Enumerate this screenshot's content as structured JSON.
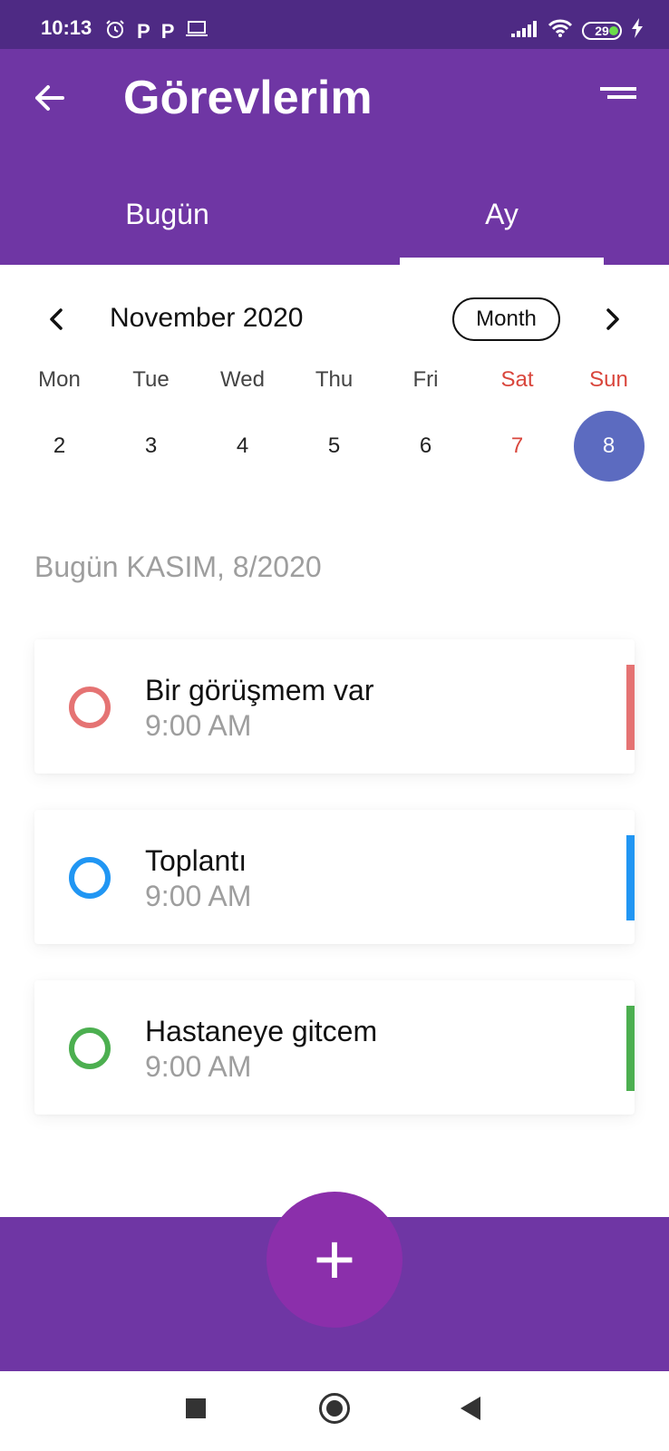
{
  "status_bar": {
    "time": "10:13",
    "battery": "29",
    "icons": [
      "alarm-icon",
      "p-icon",
      "p-icon",
      "laptop-icon",
      "signal-icon",
      "wifi-icon",
      "battery-icon",
      "charging-icon"
    ]
  },
  "app_bar": {
    "title": "Görevlerim",
    "tabs": [
      {
        "label": "Bugün",
        "selected": false
      },
      {
        "label": "Ay",
        "selected": true
      }
    ]
  },
  "calendar": {
    "month_title": "November 2020",
    "format_button": "Month",
    "weekdays": [
      "Mon",
      "Tue",
      "Wed",
      "Thu",
      "Fri",
      "Sat",
      "Sun"
    ],
    "days": [
      "2",
      "3",
      "4",
      "5",
      "6",
      "7",
      "8"
    ],
    "selected_day": "8",
    "weekend_color": "#d9463c",
    "selected_color": "#5c6bc0"
  },
  "date_heading": "Bugün KASIM, 8/2020",
  "tasks": [
    {
      "title": "Bir görüşmem var",
      "time": "9:00 AM",
      "color": "#e57373"
    },
    {
      "title": "Toplantı",
      "time": "9:00 AM",
      "color": "#2196f3"
    },
    {
      "title": "Hastaneye gitcem",
      "time": "9:00 AM",
      "color": "#4caf50"
    }
  ],
  "fab": {
    "label": "+"
  },
  "colors": {
    "primary": "#6f36a4",
    "status_bar": "#4e2a84",
    "fab": "#8b2fab"
  }
}
